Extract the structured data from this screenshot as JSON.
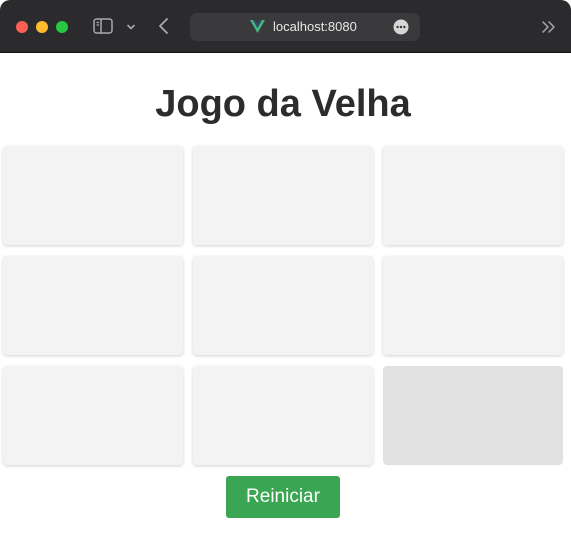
{
  "browser": {
    "url": "localhost:8080",
    "colors": {
      "close": "#fe5f57",
      "minimize": "#febc2e",
      "maximize": "#28c840",
      "vue_green": "#42b883"
    }
  },
  "page": {
    "title": "Jogo da Velha",
    "board": {
      "cells": [
        "",
        "",
        "",
        "",
        "",
        "",
        "",
        "",
        ""
      ],
      "hovered_cell_index": 8
    },
    "restart_label": "Reiniciar",
    "accent": "#3aa552"
  }
}
